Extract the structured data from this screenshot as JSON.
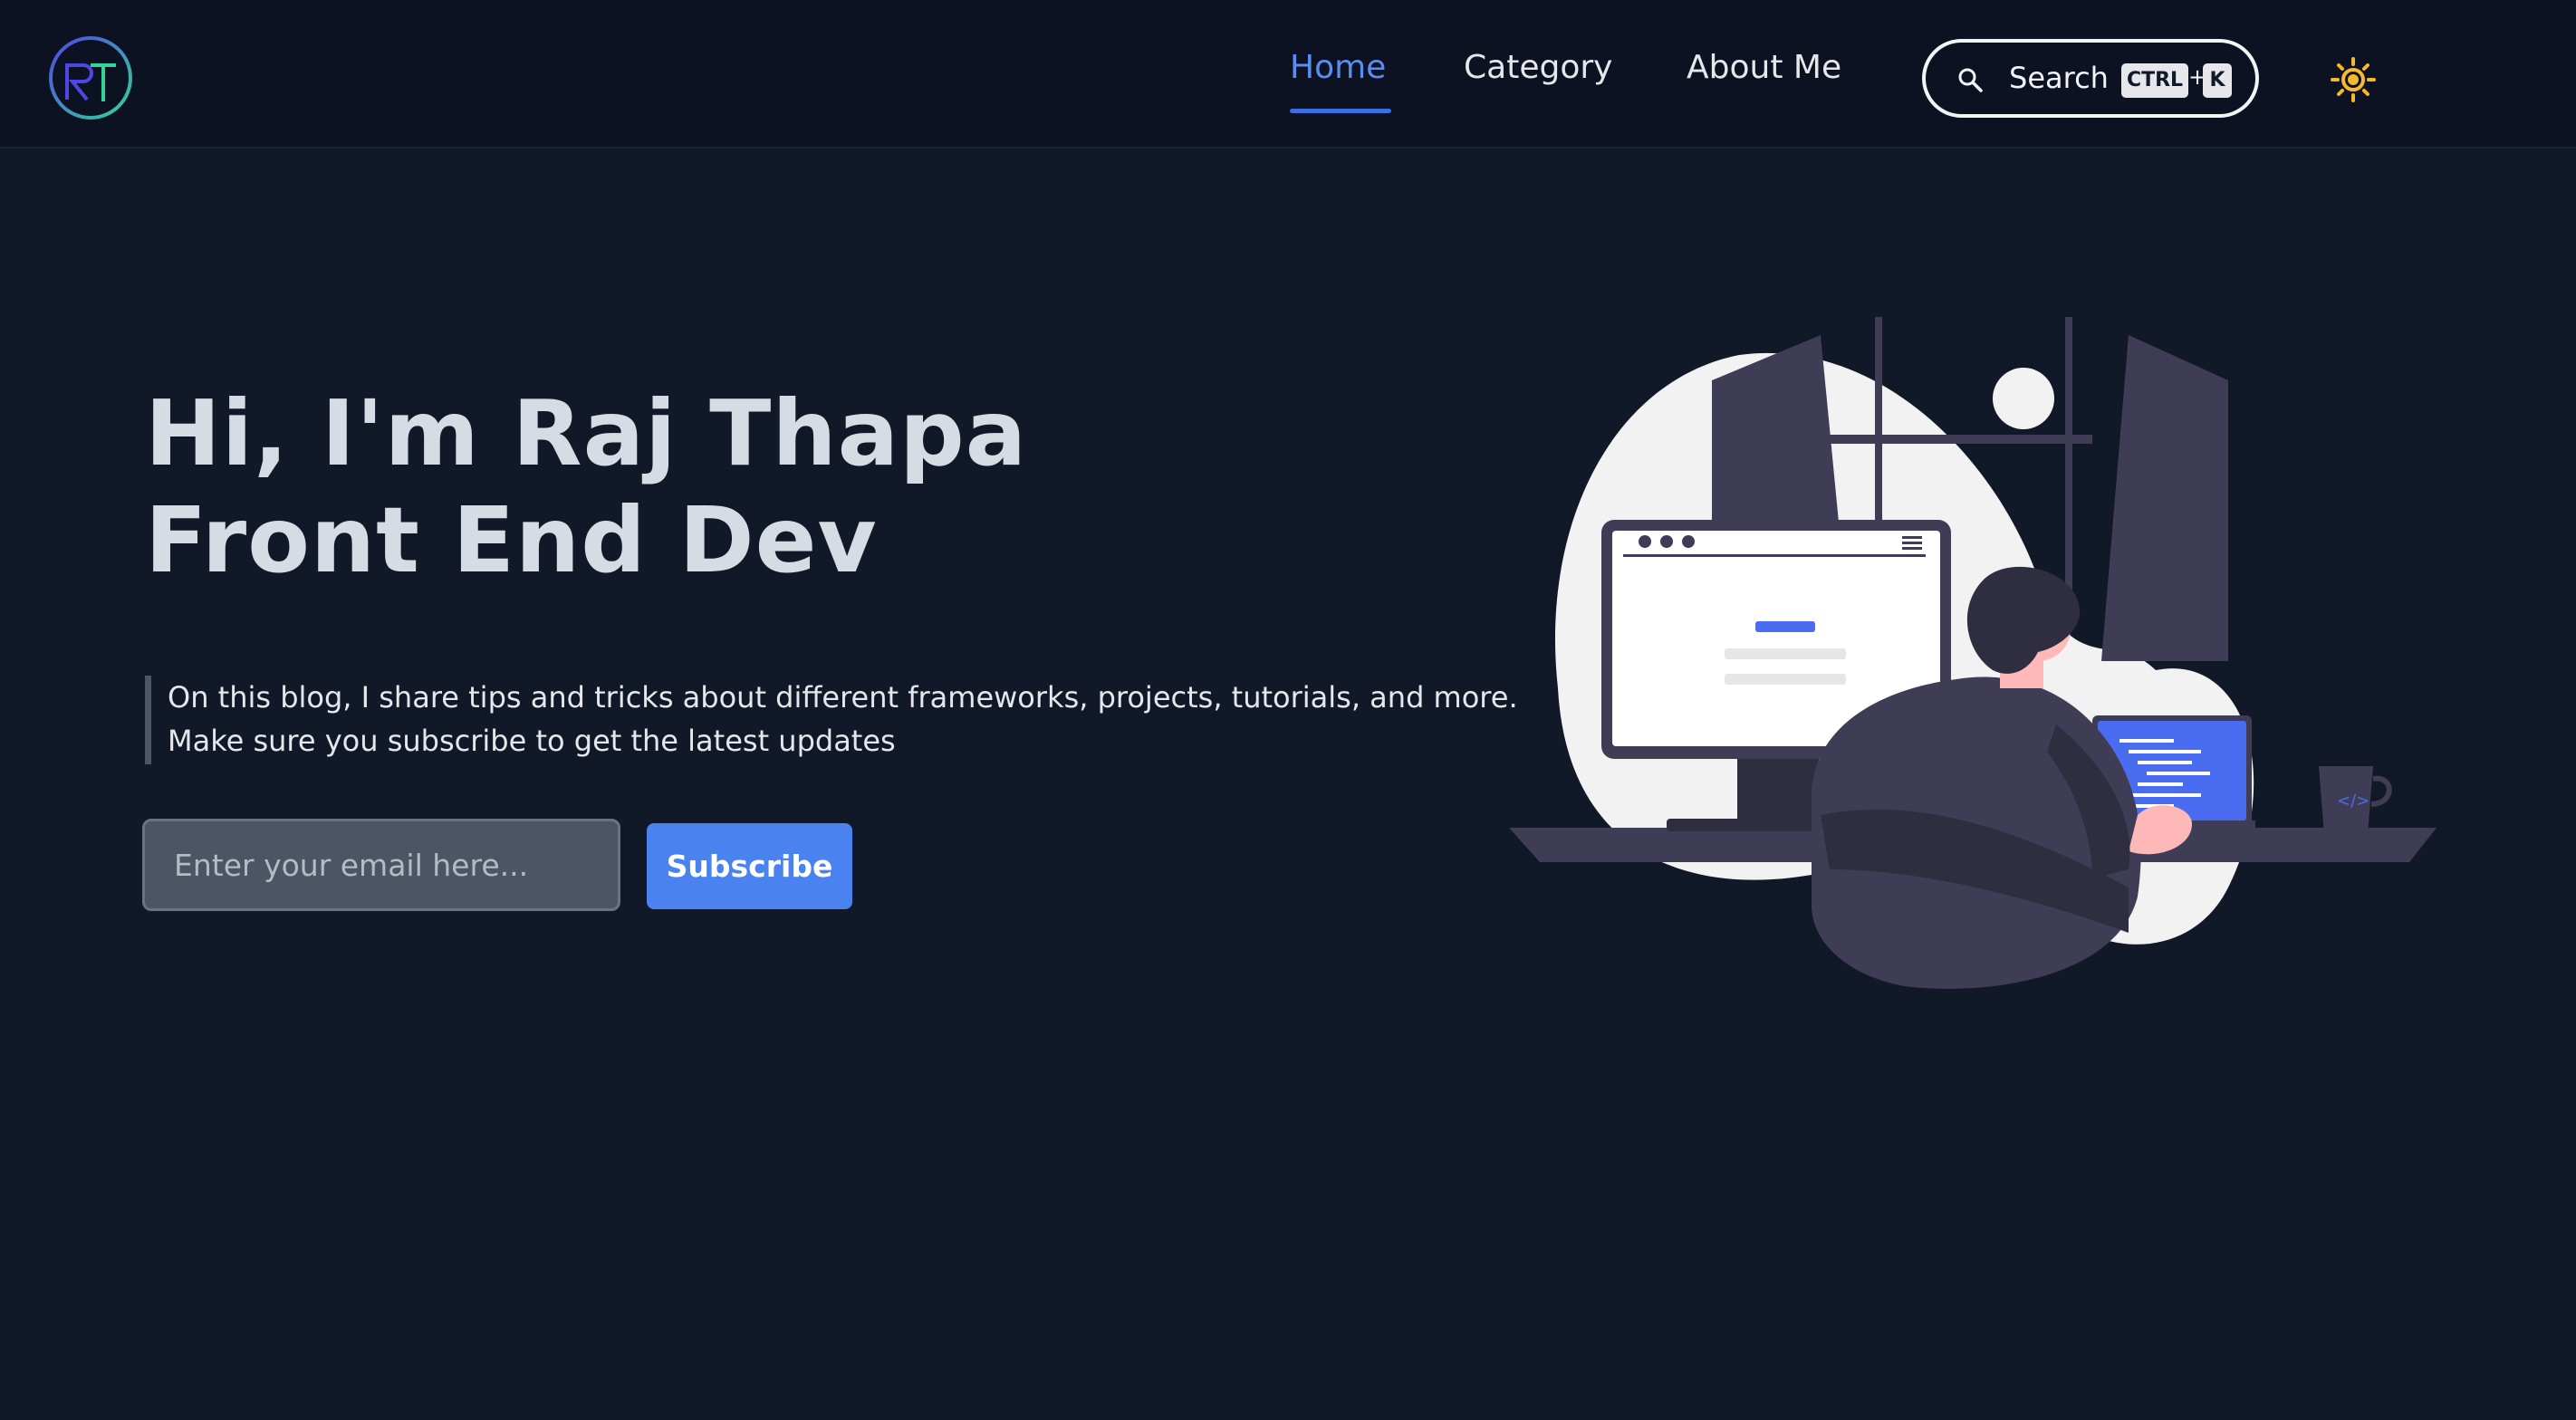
{
  "header": {
    "logo": {
      "letters": "RT",
      "icon": "rt-monogram-logo"
    },
    "nav": [
      {
        "label": "Home",
        "active": true
      },
      {
        "label": "Category",
        "active": false
      },
      {
        "label": "About Me",
        "active": false
      }
    ],
    "search": {
      "label": "Search",
      "shortcut_key1": "CTRL",
      "shortcut_sep": "+",
      "shortcut_key2": "K",
      "icon": "search-icon"
    },
    "theme_toggle": {
      "icon": "sun-icon"
    }
  },
  "hero": {
    "title_line1": "Hi, I'm Raj Thapa",
    "title_line2": "Front End Dev",
    "intro_line1": "On this blog, I share tips and tricks about different frameworks, projects, tutorials, and more.",
    "intro_line2": "Make sure you subscribe to get the latest updates",
    "email_placeholder": "Enter your email here...",
    "subscribe_label": "Subscribe",
    "illustration": "developer-at-desk-illustration"
  },
  "colors": {
    "page_bg": "#111827",
    "header_bg": "#0c1221",
    "accent": "#4a82ef",
    "active_nav": "#5b8def",
    "sun": "#f5b82e"
  }
}
